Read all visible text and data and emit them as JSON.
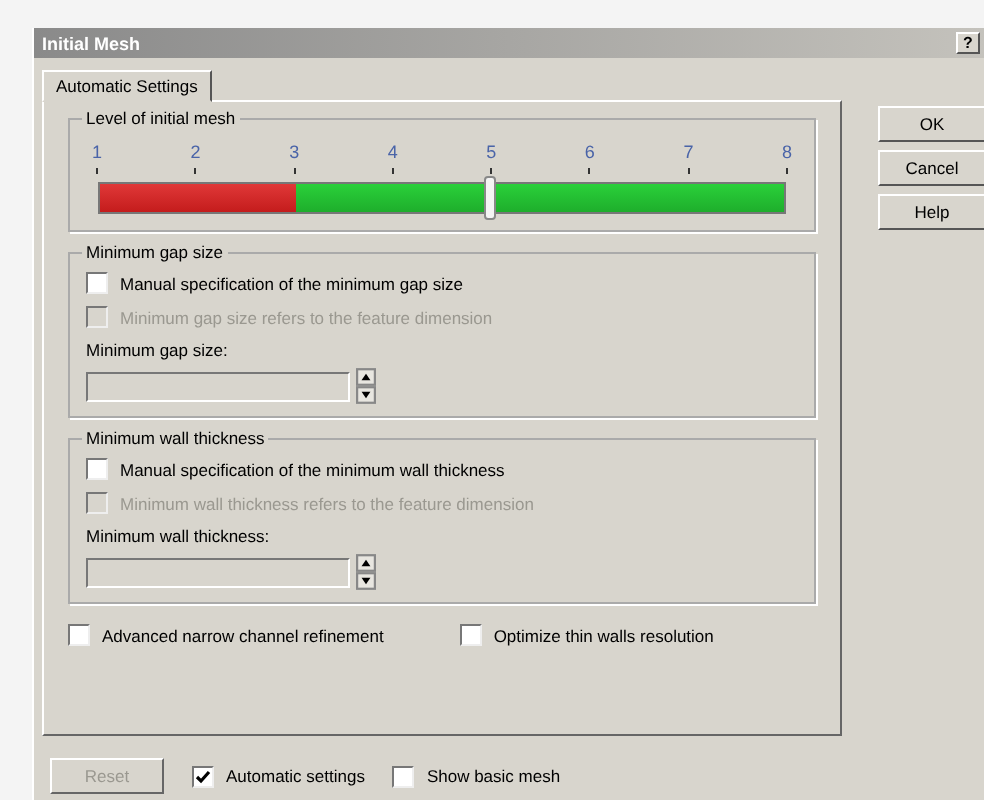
{
  "window": {
    "title": "Initial Mesh",
    "help_glyph": "?"
  },
  "tabs": [
    {
      "label": "Automatic Settings",
      "selected": true
    }
  ],
  "mesh_level": {
    "title": "Level of initial mesh",
    "ticks": [
      "1",
      "2",
      "3",
      "4",
      "5",
      "6",
      "7",
      "8"
    ],
    "level": 0.571
  },
  "groups": [
    {
      "title": "Minimum gap size",
      "checks": [
        {
          "label": "Manual specification of the minimum gap size",
          "checked": false,
          "disabled": false
        },
        {
          "label": "Minimum gap size refers to the feature dimension",
          "checked": false,
          "disabled": true
        }
      ],
      "field_label": "Minimum gap size:"
    },
    {
      "title": "Minimum wall thickness",
      "checks": [
        {
          "label": "Manual specification of the minimum wall thickness",
          "checked": false,
          "disabled": false
        },
        {
          "label": "Minimum wall thickness refers to the feature dimension",
          "checked": false,
          "disabled": true
        }
      ],
      "field_label": "Minimum wall thickness:"
    }
  ],
  "options": [
    {
      "label": "Advanced narrow channel refinement",
      "checked": false
    },
    {
      "label": "Optimize thin walls resolution",
      "checked": false
    }
  ],
  "buttons": [
    "OK",
    "Cancel",
    "Help"
  ],
  "footer": {
    "reset": {
      "label": "Reset",
      "disabled": true
    },
    "checks": [
      {
        "label": "Automatic settings",
        "checked": true
      },
      {
        "label": "Show basic mesh",
        "checked": false
      }
    ]
  }
}
